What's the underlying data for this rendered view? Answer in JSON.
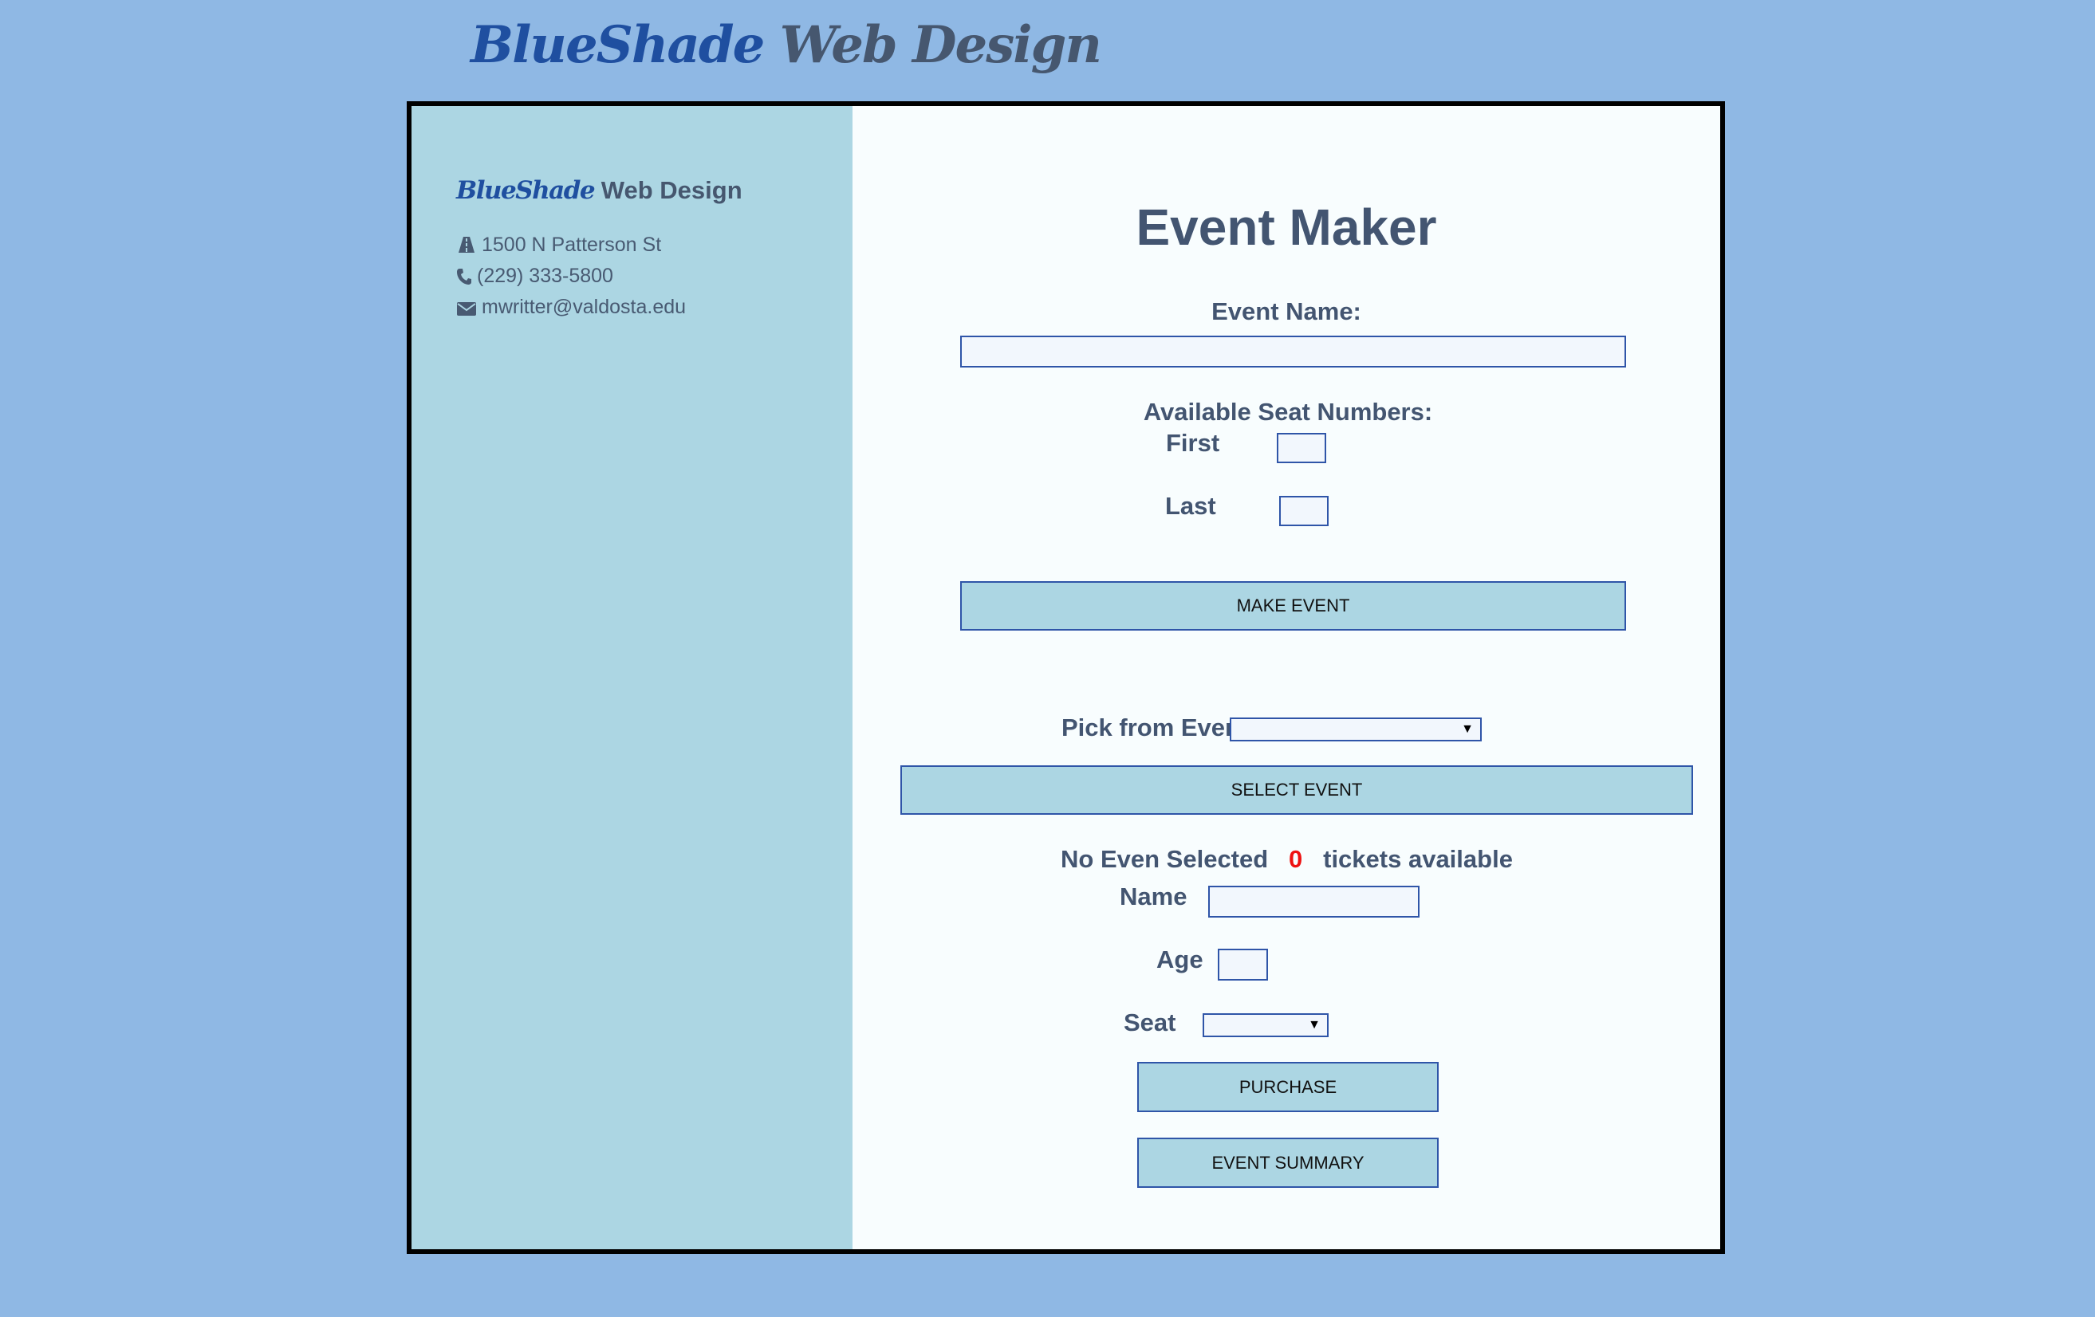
{
  "header": {
    "logo_part1": "BlueShade",
    "logo_part2": "Web Design"
  },
  "sidebar": {
    "brand_part1": "BlueShade",
    "brand_part2": "Web Design",
    "address": "1500 N Patterson St",
    "phone": "(229) 333-5800",
    "email": "mwritter@valdosta.edu",
    "icons": [
      "road-icon",
      "phone-icon",
      "envelope-icon"
    ]
  },
  "main": {
    "title": "Event Maker",
    "event_name_label": "Event Name:",
    "event_name_value": "",
    "seat_numbers_label": "Available Seat Numbers:",
    "first_label": "First",
    "first_value": "",
    "last_label": "Last",
    "last_value": "",
    "make_event_button": "MAKE EVENT",
    "pick_events_label": "Pick from Events:",
    "pick_events_selected": "",
    "select_event_button": "SELECT EVENT",
    "status_event": "No Even Selected",
    "tickets_count": "0",
    "tickets_label": "tickets available",
    "name_label": "Name",
    "name_value": "",
    "age_label": "Age",
    "age_value": "",
    "seat_label": "Seat",
    "seat_selected": "",
    "purchase_button": "PURCHASE",
    "summary_button": "EVENT SUMMARY"
  },
  "colors": {
    "page_bg": "#8fb8e4",
    "sidebar_bg": "#acd6e3",
    "main_bg": "#f8fdfe",
    "logo_blue": "#1f4fa0",
    "text": "#435571",
    "tickets_count": "#ee1111"
  }
}
